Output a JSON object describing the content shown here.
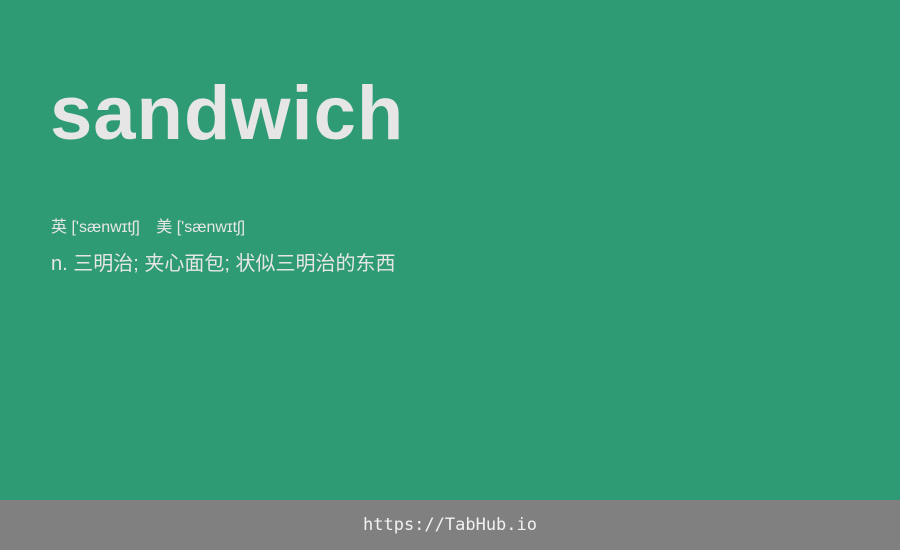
{
  "card": {
    "word": "sandwich",
    "phonetics": {
      "uk_label": "英",
      "uk_ipa": "['sænwɪtʃ]",
      "us_label": "美",
      "us_ipa": "['sænwɪtʃ]"
    },
    "definition": "n. 三明治; 夹心面包; 状似三明治的东西"
  },
  "footer": {
    "link_text": "https://TabHub.io"
  },
  "colors": {
    "background": "#2e9b74",
    "text": "#e6e6e6",
    "footer_background": "#808080"
  }
}
